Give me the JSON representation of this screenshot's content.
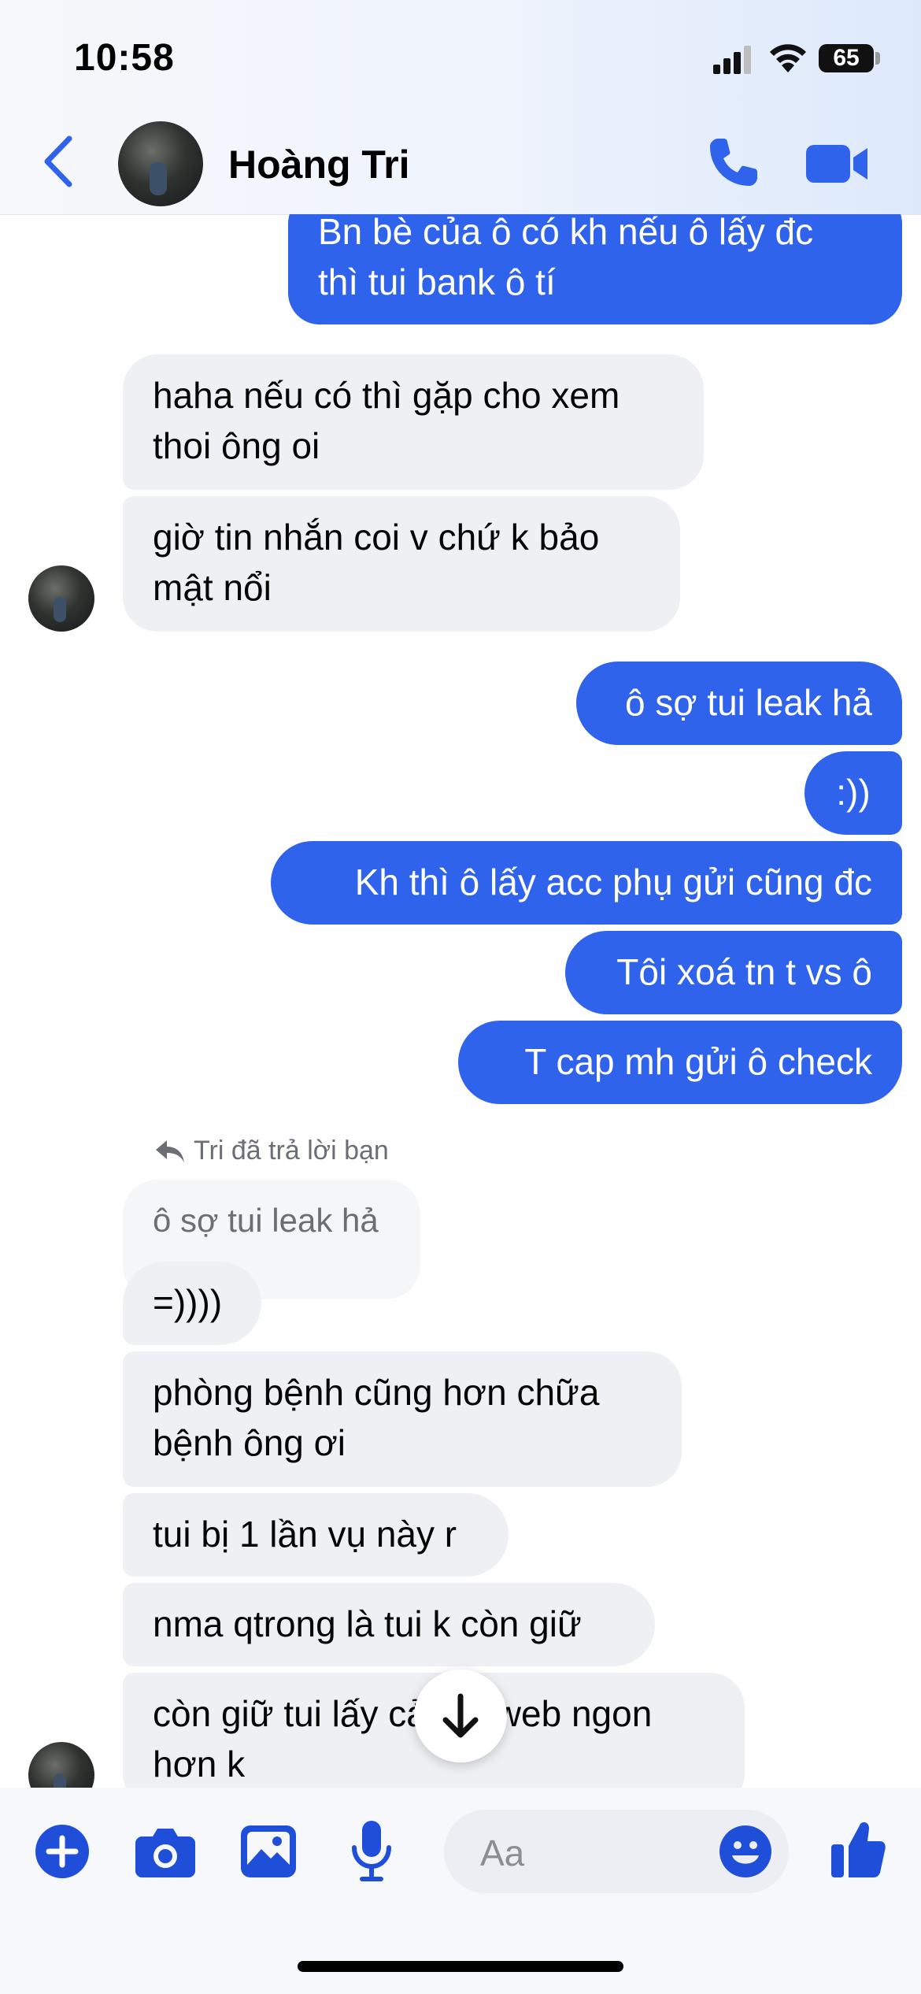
{
  "status_bar": {
    "time": "10:58",
    "battery": "65"
  },
  "header": {
    "contact_name": "Hoàng Tri"
  },
  "messages": [
    {
      "side": "out",
      "text": "Bn bè của ô có kh nếu ô lấy đc\nthì tui bank ô tí"
    },
    {
      "side": "in",
      "text": "haha nếu có thì gặp cho xem\nthoi ông oi"
    },
    {
      "side": "in",
      "text": "giờ tin nhắn coi v chứ k bảo\nmật nổi"
    },
    {
      "side": "out",
      "text": "ô sợ tui leak hả"
    },
    {
      "side": "out",
      "text": ":))"
    },
    {
      "side": "out",
      "text": "Kh thì ô lấy acc phụ gửi cũng đc"
    },
    {
      "side": "out",
      "text": "Tôi xoá tn t vs ô"
    },
    {
      "side": "out",
      "text": "T cap mh gửi ô check"
    },
    {
      "side": "in",
      "text": "=))))"
    },
    {
      "side": "in",
      "text": "phòng bệnh cũng hơn chữa\nbệnh ông ơi"
    },
    {
      "side": "in",
      "text": "tui bị 1 lần vụ này r"
    },
    {
      "side": "in",
      "text": "nma qtrong là tui k còn giữ"
    },
    {
      "side": "in",
      "text": "còn giữ tui lấy cả lên web ngon\nhơn k"
    }
  ],
  "reply": {
    "label": "Tri đã trả lời bạn",
    "quoted_text": "ô sợ tui leak hả"
  },
  "composer": {
    "placeholder": "Aa"
  },
  "colors": {
    "accent": "#2f63eb",
    "incoming_bubble": "#eff0f4",
    "icon_blue": "#1f4fd8"
  }
}
